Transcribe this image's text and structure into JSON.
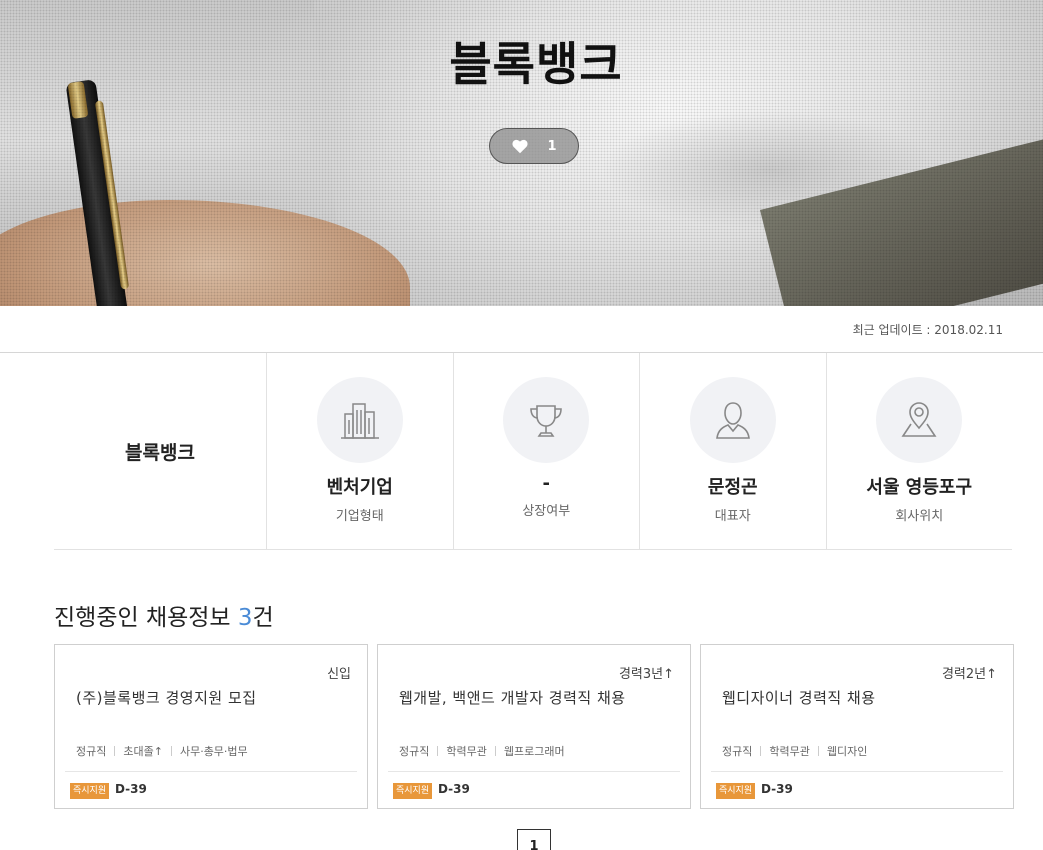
{
  "hero": {
    "company_name": "블록뱅크",
    "like_count": "1"
  },
  "last_update": "최근 업데이트 : 2018.02.11",
  "company_info": {
    "name": "블록뱅크",
    "items": [
      {
        "icon": "building-icon",
        "value": "벤처기업",
        "label": "기업형태"
      },
      {
        "icon": "trophy-icon",
        "value": "-",
        "label": "상장여부"
      },
      {
        "icon": "person-icon",
        "value": "문정곤",
        "label": "대표자"
      },
      {
        "icon": "location-pin-icon",
        "value": "서울 영등포구",
        "label": "회사위치"
      }
    ]
  },
  "jobs": {
    "heading": "진행중인 채용정보 ",
    "count": "3",
    "unit": "건",
    "badge_label": "즉시지원",
    "cards": [
      {
        "career": "신입",
        "title": "(주)블록뱅크 경영지원 모집",
        "tags": [
          "정규직",
          "초대졸↑",
          "사무·총무·법무"
        ],
        "dday": "D-39"
      },
      {
        "career": "경력3년↑",
        "title": "웹개발, 백앤드 개발자 경력직 채용",
        "tags": [
          "정규직",
          "학력무관",
          "웹프로그래머"
        ],
        "dday": "D-39"
      },
      {
        "career": "경력2년↑",
        "title": "웹디자이너 경력직 채용",
        "tags": [
          "정규직",
          "학력무관",
          "웹디자인"
        ],
        "dday": "D-39"
      }
    ]
  },
  "pagination": {
    "current": "1"
  },
  "colors": {
    "accent_blue": "#4a8bd6",
    "badge_orange": "#e8973a"
  }
}
